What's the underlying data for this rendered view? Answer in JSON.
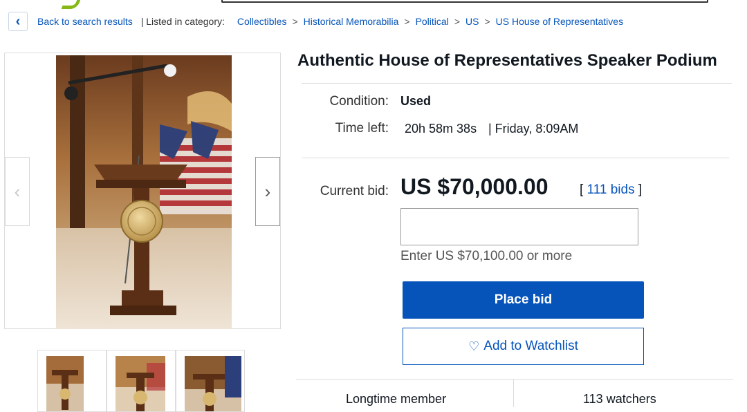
{
  "header": {
    "back_label": "Back to search results",
    "listed_label": "| Listed in category:",
    "breadcrumb": [
      "Collectibles",
      "Historical Memorabilia",
      "Political",
      "US",
      "US House of Representatives"
    ]
  },
  "item": {
    "title": "Authentic House of Representatives Speaker Podium",
    "condition_label": "Condition:",
    "condition_value": "Used",
    "time_left_label": "Time left:",
    "time_left_value": "20h 58m 38s",
    "end_time": "| Friday, 8:09AM",
    "current_bid_label": "Current bid:",
    "current_bid_value": "US $70,000.00",
    "bids_count": "111 bids",
    "bid_hint": "Enter US $70,100.00 or more",
    "place_bid_label": "Place bid",
    "watchlist_label": "Add to Watchlist"
  },
  "gallery": {
    "prev_glyph": "‹",
    "next_glyph": "›"
  },
  "stats": {
    "member": "Longtime member",
    "watchers": "113 watchers"
  },
  "colors": {
    "link": "#0654ba",
    "primary_button": "#0654ba",
    "brand_green": "#86b817"
  }
}
